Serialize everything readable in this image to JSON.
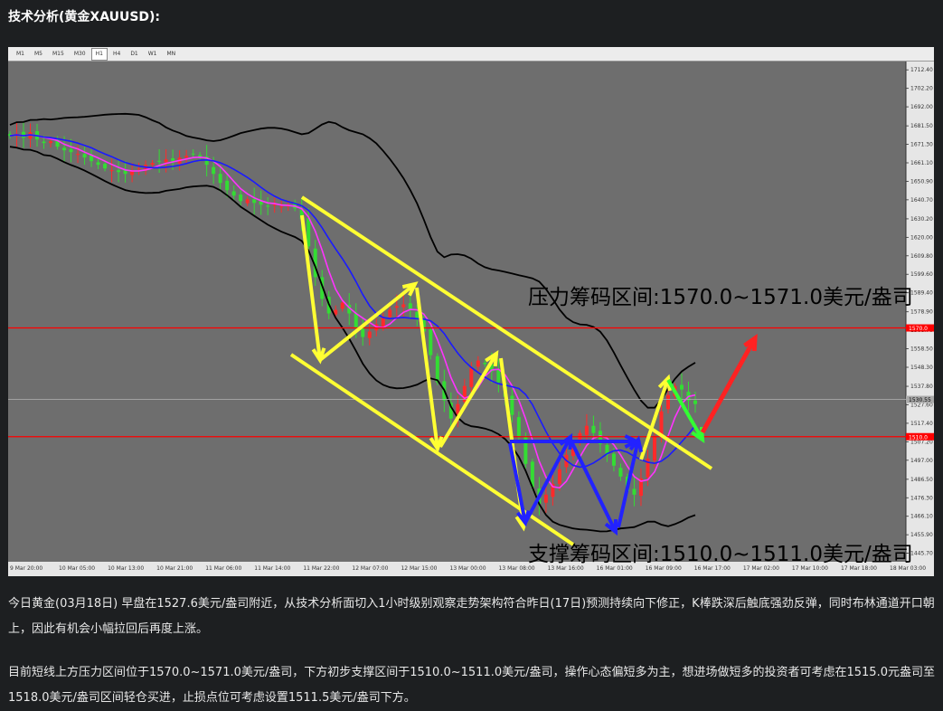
{
  "page": {
    "title": "技术分析(黄金XAUUSD):",
    "paragraph1": "今日黄金(03月18日) 早盘在1527.6美元/盎司附近，从技术分析面切入1小时级别观察走势架构符合昨日(17日)预测持续向下修正，K棒跌深后触底强劲反弹，同时布林通道开口朝上，因此有机会小幅拉回后再度上涨。",
    "paragraph2": "目前短线上方压力区间位于1570.0~1571.0美元/盎司，下方初步支撑区间于1510.0~1511.0美元/盎司，操作心态偏短多为主，想进场做短多的投资者可考虑在1515.0元盎司至1518.0美元/盎司区间轻仓买进，止损点位可考虑设置1511.5美元/盎司下方。"
  },
  "timeframes": [
    "M1",
    "M5",
    "M15",
    "M30",
    "H1",
    "H4",
    "D1",
    "W1",
    "MN"
  ],
  "active_timeframe": "H1",
  "colors": {
    "chart_bg": "#6e6e6e",
    "bull": "#ff2a2a",
    "bear": "#33dd33",
    "bollinger": "#000000",
    "ma_fast": "#ff33ff",
    "ma_slow": "#1a1aff",
    "level_line": "#ff0000",
    "arrow_yellow": "#ffff33",
    "arrow_blue": "#2222ff",
    "arrow_green": "#33ff33",
    "arrow_red": "#ff2222"
  },
  "chart_data": {
    "type": "candlestick",
    "symbol": "XAUUSD",
    "timeframe": "H1",
    "ylim": [
      1441.0,
      1717.0
    ],
    "yticks": [
      "1712.40",
      "1702.20",
      "1692.00",
      "1681.50",
      "1671.30",
      "1661.10",
      "1650.90",
      "1640.70",
      "1630.20",
      "1620.00",
      "1609.80",
      "1599.60",
      "1589.40",
      "1578.90",
      "1568.70",
      "1558.50",
      "1548.30",
      "1537.80",
      "1527.60",
      "1517.40",
      "1507.20",
      "1497.00",
      "1486.50",
      "1476.30",
      "1466.10",
      "1455.90",
      "1445.70"
    ],
    "xticks": [
      "9 Mar 20:00",
      "10 Mar 05:00",
      "10 Mar 13:00",
      "10 Mar 21:00",
      "11 Mar 06:00",
      "11 Mar 14:00",
      "11 Mar 22:00",
      "12 Mar 07:00",
      "12 Mar 15:00",
      "13 Mar 00:00",
      "13 Mar 08:00",
      "13 Mar 16:00",
      "16 Mar 01:00",
      "16 Mar 09:00",
      "16 Mar 17:00",
      "17 Mar 02:00",
      "17 Mar 10:00",
      "17 Mar 18:00",
      "18 Mar 03:00"
    ],
    "current_price": "1530.55",
    "resistance_level": 1570.0,
    "resistance_label": "1570.0",
    "support_level": 1510.0,
    "support_label": "1510.0",
    "resistance_text": "压力筹码区间:1570.0~1571.0美元/盎司",
    "support_text": "支撑筹码区间:1510.0~1511.0美元/盎司",
    "close": [
      1676,
      1677,
      1675,
      1678,
      1674,
      1672,
      1673,
      1670,
      1668,
      1667,
      1666,
      1664,
      1662,
      1660,
      1658,
      1657,
      1656,
      1655,
      1657,
      1658,
      1660,
      1661,
      1662,
      1663,
      1662,
      1664,
      1665,
      1666,
      1664,
      1660,
      1655,
      1650,
      1646,
      1643,
      1640,
      1641,
      1639,
      1638,
      1637,
      1638,
      1637,
      1638,
      1636,
      1630,
      1615,
      1598,
      1586,
      1578,
      1580,
      1584,
      1578,
      1570,
      1565,
      1568,
      1572,
      1576,
      1580,
      1582,
      1583,
      1580,
      1575,
      1568,
      1555,
      1540,
      1530,
      1520,
      1528,
      1538,
      1548,
      1552,
      1550,
      1546,
      1540,
      1532,
      1522,
      1510,
      1495,
      1482,
      1473,
      1478,
      1484,
      1492,
      1500,
      1506,
      1512,
      1516,
      1512,
      1506,
      1500,
      1494,
      1488,
      1480,
      1478,
      1487,
      1498,
      1510,
      1524,
      1533,
      1538,
      1536,
      1530,
      1528
    ]
  }
}
